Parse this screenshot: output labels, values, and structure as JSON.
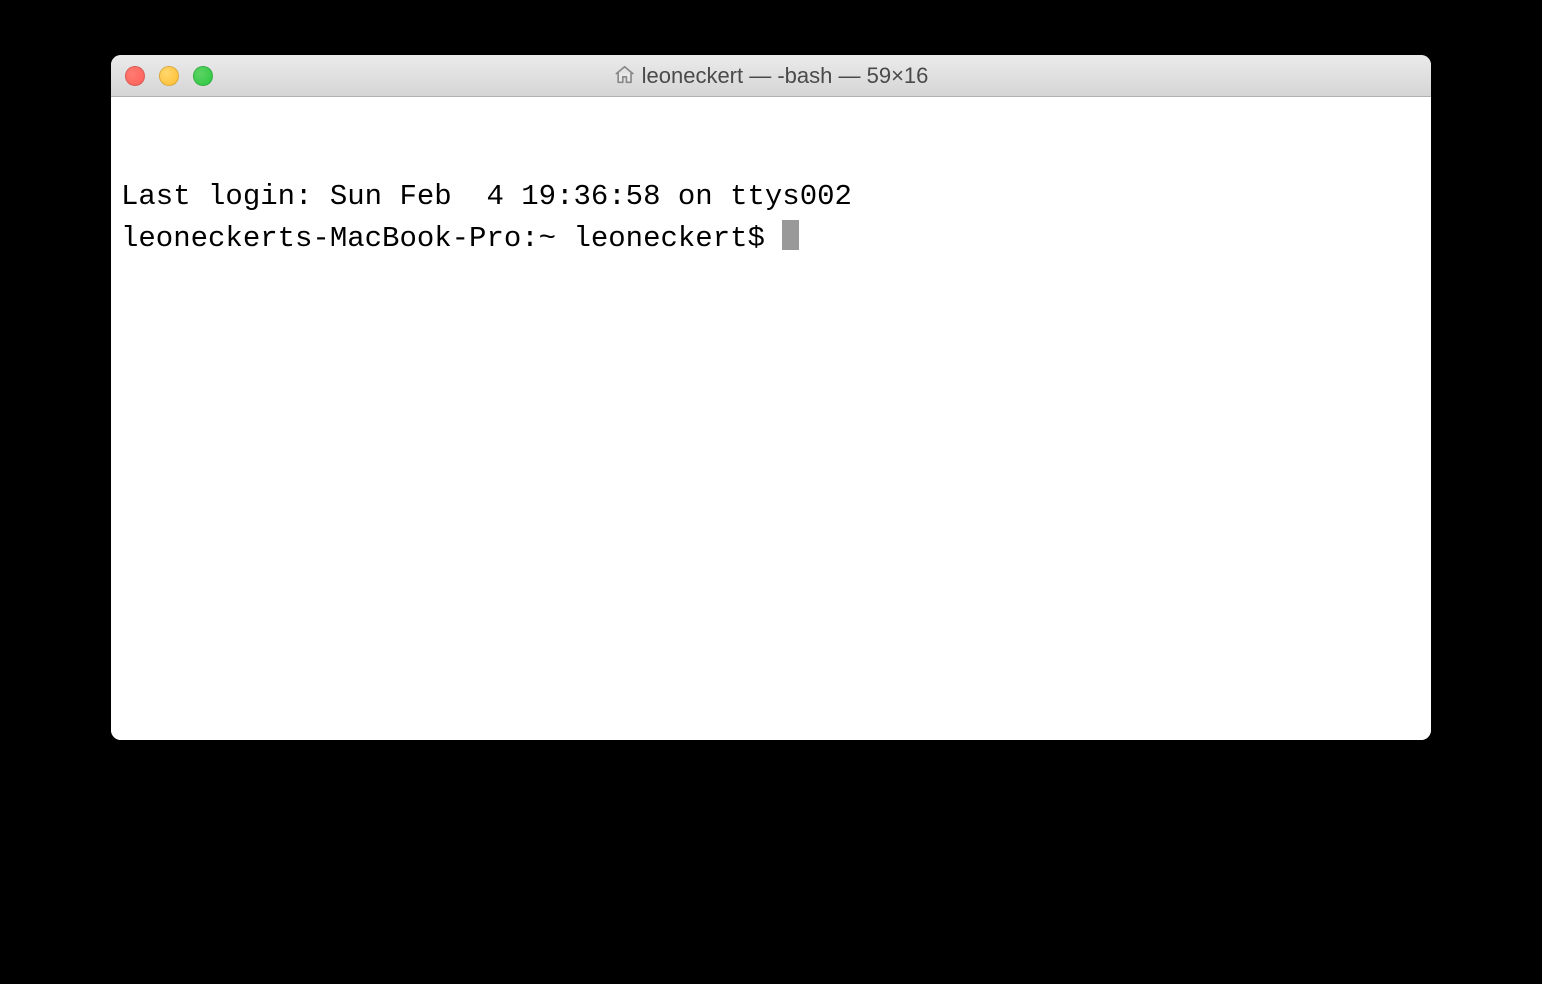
{
  "window": {
    "title": "leoneckert — -bash — 59×16",
    "home_icon": "home-icon"
  },
  "terminal": {
    "last_login": "Last login: Sun Feb  4 19:36:58 on ttys002",
    "prompt": "leoneckerts-MacBook-Pro:~ leoneckert$ "
  }
}
